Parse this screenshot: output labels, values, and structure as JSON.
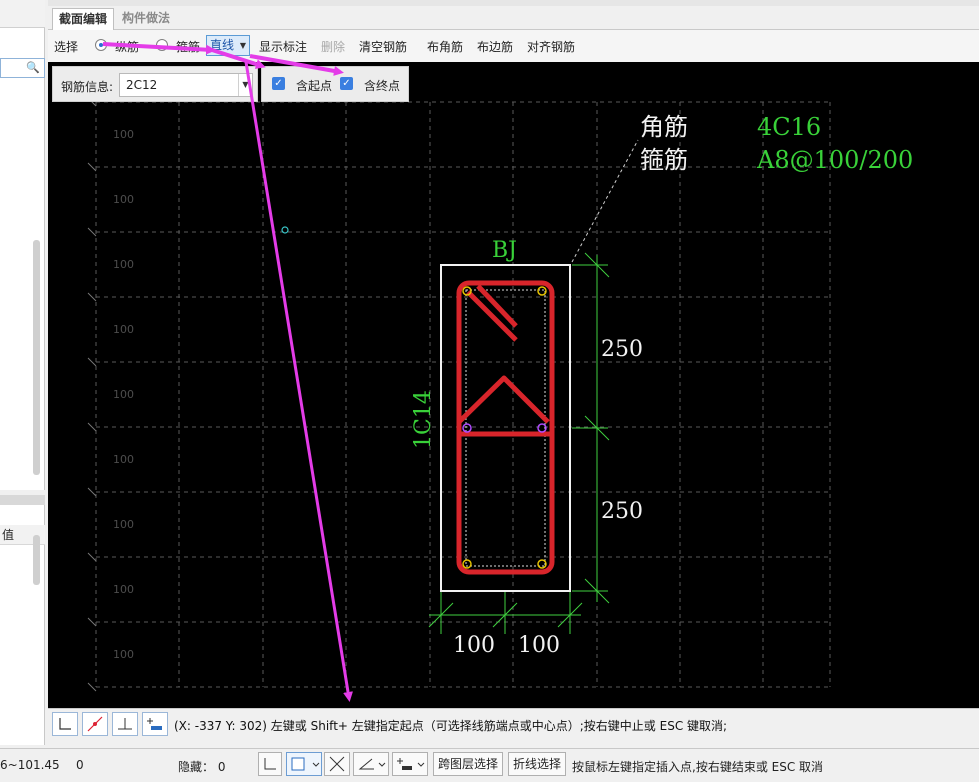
{
  "tabs": [
    {
      "label": "截面编辑",
      "active": true
    },
    {
      "label": "构件做法",
      "active": false
    }
  ],
  "toolbar": {
    "select": "选择",
    "longitudinal": "纵筋",
    "stirrup": "箍筋",
    "line": "直线",
    "show_label": "显示标注",
    "delete": "删除",
    "clear_rebar": "清空钢筋",
    "corner_rebar": "布角筋",
    "edge_rebar": "布边筋",
    "align_rebar": "对齐钢筋"
  },
  "info": {
    "rebar_label": "钢筋信息:",
    "rebar_value": "2C12",
    "include_start": "含起点",
    "include_end": "含终点"
  },
  "left_panel": {
    "header": "值"
  },
  "canvas": {
    "grid_label": "100",
    "corner_title": "角筋",
    "corner_value": "4C16",
    "stirrup_title": "箍筋",
    "stirrup_value": "A8@100/200",
    "section_name": "BJ",
    "side_label": "1C14",
    "dim_v1": "250",
    "dim_v2": "250",
    "dim_h1": "100",
    "dim_h2": "100"
  },
  "command": {
    "text": "(X: -337 Y: 302)  左键或 Shift+ 左键指定起点（可选择线筋端点或中心点）;按右键中止或 ESC 键取消;"
  },
  "status": {
    "coords": "6~101.45",
    "zero": "0",
    "hidden": "隐藏：  0",
    "cross_layer": "跨图层选择",
    "polyline_select": "折线选择",
    "hint": "按鼠标左键指定插入点,按右键结束或 ESC 取消"
  },
  "colors": {
    "canvas_bg": "#000000",
    "rebar_red": "#d8252b",
    "green": "#39d139",
    "arrow_magenta": "#e43ce8"
  }
}
